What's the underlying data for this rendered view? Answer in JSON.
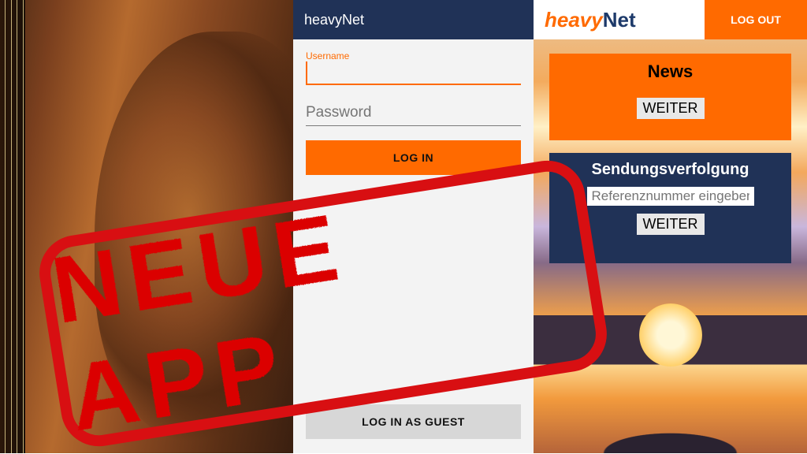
{
  "stamp_text_1": "NEUE",
  "stamp_text_2": "APP",
  "login": {
    "header_title": "heavyNet",
    "username_label": "Username",
    "password_placeholder": "Password",
    "login_button": "LOG IN",
    "guest_button": "LOG IN AS GUEST"
  },
  "home": {
    "brand_prefix": "heavy",
    "brand_suffix": "Net",
    "logout_button": "LOG OUT",
    "news": {
      "title": "News",
      "weiter": "WEITER"
    },
    "tracking": {
      "title": "Sendungsverfolgung",
      "placeholder": "Referenznummer eingeben",
      "weiter": "WEITER"
    }
  },
  "colors": {
    "accent": "#ff6a00",
    "dark_blue": "#203257",
    "stamp_red": "#d80f12"
  }
}
